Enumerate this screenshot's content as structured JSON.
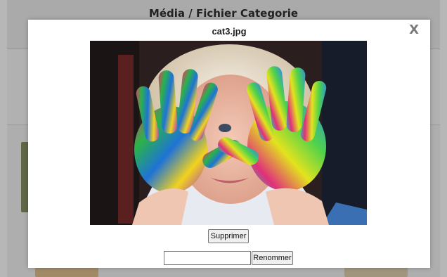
{
  "page": {
    "title": "Média / Fichier Categorie"
  },
  "modal": {
    "title": "cat3.jpg",
    "close_label": "X",
    "image_alt": "cat3.jpg",
    "delete_label": "Supprimer",
    "rename_value": "",
    "rename_label": "Renommer"
  }
}
